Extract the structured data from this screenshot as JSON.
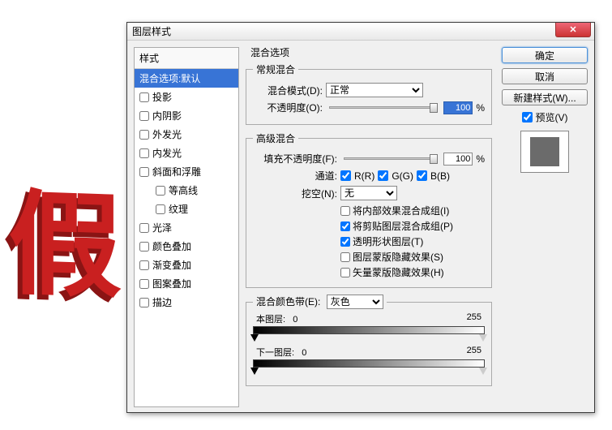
{
  "bg_text": "假",
  "dialog": {
    "title": "图层样式"
  },
  "styles": {
    "header": "样式",
    "items": [
      {
        "label": "混合选项:默认",
        "selected": true,
        "checkbox": false
      },
      {
        "label": "投影",
        "checkbox": true
      },
      {
        "label": "内阴影",
        "checkbox": true
      },
      {
        "label": "外发光",
        "checkbox": true
      },
      {
        "label": "内发光",
        "checkbox": true
      },
      {
        "label": "斜面和浮雕",
        "checkbox": true
      },
      {
        "label": "等高线",
        "checkbox": true,
        "child": true
      },
      {
        "label": "纹理",
        "checkbox": true,
        "child": true
      },
      {
        "label": "光泽",
        "checkbox": true
      },
      {
        "label": "颜色叠加",
        "checkbox": true
      },
      {
        "label": "渐变叠加",
        "checkbox": true
      },
      {
        "label": "图案叠加",
        "checkbox": true
      },
      {
        "label": "描边",
        "checkbox": true
      }
    ]
  },
  "blend_options": {
    "title": "混合选项",
    "general": {
      "title": "常规混合",
      "mode_label": "混合模式(D):",
      "mode_value": "正常",
      "opacity_label": "不透明度(O):",
      "opacity_value": "100",
      "percent": "%"
    },
    "advanced": {
      "title": "高级混合",
      "fill_label": "填充不透明度(F):",
      "fill_value": "100",
      "percent": "%",
      "channels_label": "通道:",
      "ch_r": "R(R)",
      "ch_g": "G(G)",
      "ch_b": "B(B)",
      "knockout_label": "挖空(N):",
      "knockout_value": "无",
      "opts": [
        {
          "label": "将内部效果混合成组(I)",
          "checked": false
        },
        {
          "label": "将剪贴图层混合成组(P)",
          "checked": true
        },
        {
          "label": "透明形状图层(T)",
          "checked": true
        },
        {
          "label": "图层蒙版隐藏效果(S)",
          "checked": false
        },
        {
          "label": "矢量蒙版隐藏效果(H)",
          "checked": false
        }
      ]
    },
    "blend_if": {
      "title": "混合颜色带(E):",
      "value": "灰色",
      "this_label": "本图层:",
      "this_lo": "0",
      "this_hi": "255",
      "under_label": "下一图层:",
      "under_lo": "0",
      "under_hi": "255"
    }
  },
  "buttons": {
    "ok": "确定",
    "cancel": "取消",
    "new_style": "新建样式(W)...",
    "preview": "预览(V)"
  }
}
